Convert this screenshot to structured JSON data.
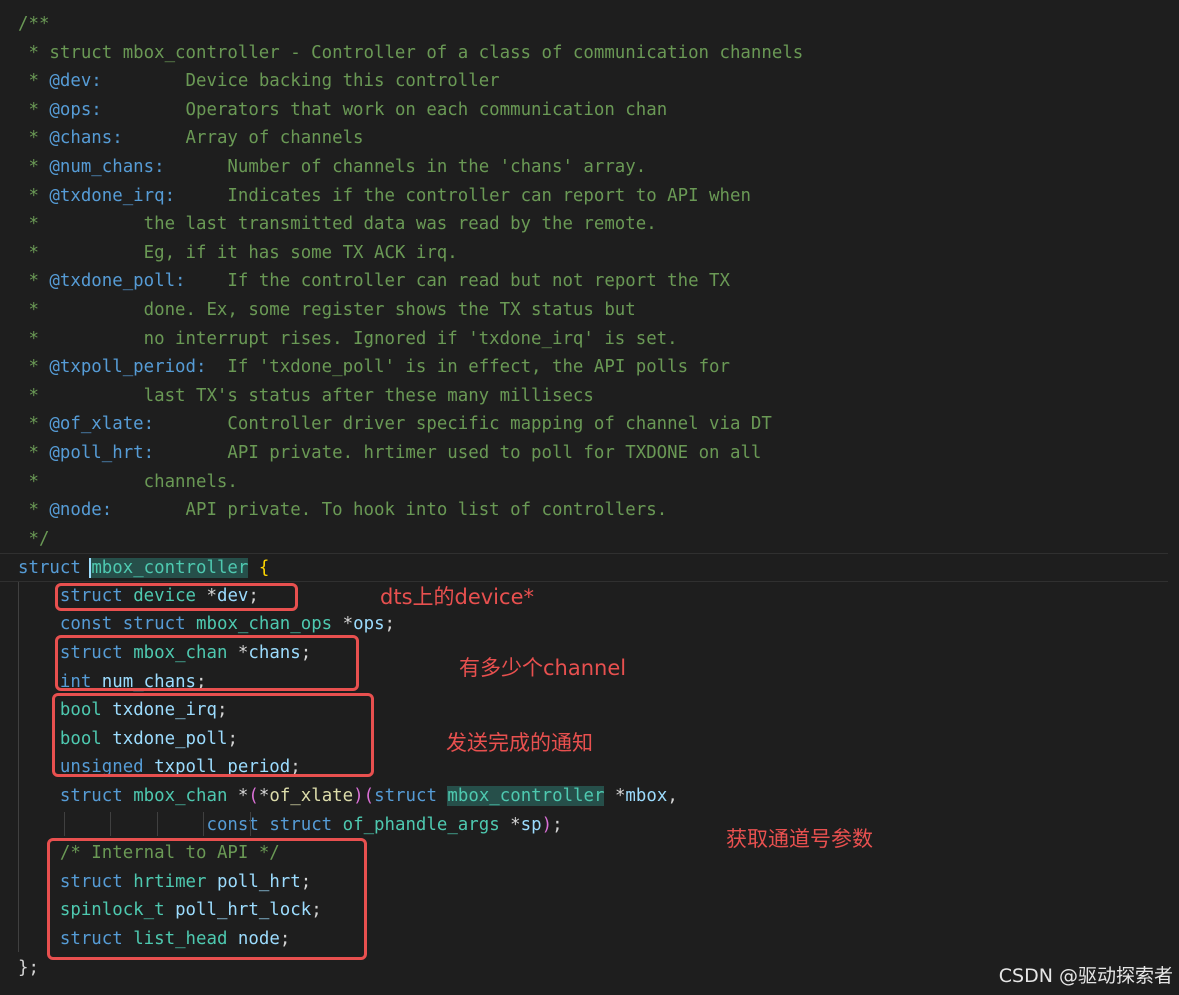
{
  "code_lines": [
    [
      [
        "/**",
        "cmt"
      ]
    ],
    [
      [
        " * struct mbox_controller - Controller of a class of communication channels",
        "cmt"
      ]
    ],
    [
      [
        " * ",
        "cmt"
      ],
      [
        "@dev:",
        "cdoc"
      ],
      [
        "        Device backing this controller",
        "cmt"
      ]
    ],
    [
      [
        " * ",
        "cmt"
      ],
      [
        "@ops:",
        "cdoc"
      ],
      [
        "        Operators that work on each communication chan",
        "cmt"
      ]
    ],
    [
      [
        " * ",
        "cmt"
      ],
      [
        "@chans:",
        "cdoc"
      ],
      [
        "      Array of channels",
        "cmt"
      ]
    ],
    [
      [
        " * ",
        "cmt"
      ],
      [
        "@num_chans:",
        "cdoc"
      ],
      [
        "      Number of channels in the 'chans' array.",
        "cmt"
      ]
    ],
    [
      [
        " * ",
        "cmt"
      ],
      [
        "@txdone_irq:",
        "cdoc"
      ],
      [
        "     Indicates if the controller can report to API when",
        "cmt"
      ]
    ],
    [
      [
        " *          the last transmitted data was read by the remote.",
        "cmt"
      ]
    ],
    [
      [
        " *          Eg, if it has some TX ACK irq.",
        "cmt"
      ]
    ],
    [
      [
        " * ",
        "cmt"
      ],
      [
        "@txdone_poll:",
        "cdoc"
      ],
      [
        "    If the controller can read but not report the TX",
        "cmt"
      ]
    ],
    [
      [
        " *          done. Ex, some register shows the TX status but",
        "cmt"
      ]
    ],
    [
      [
        " *          no interrupt rises. Ignored if 'txdone_irq' is set.",
        "cmt"
      ]
    ],
    [
      [
        " * ",
        "cmt"
      ],
      [
        "@txpoll_period:",
        "cdoc"
      ],
      [
        "  If 'txdone_poll' is in effect, the API polls for",
        "cmt"
      ]
    ],
    [
      [
        " *          last TX's status after these many millisecs",
        "cmt"
      ]
    ],
    [
      [
        " * ",
        "cmt"
      ],
      [
        "@of_xlate:",
        "cdoc"
      ],
      [
        "       Controller driver specific mapping of channel via DT",
        "cmt"
      ]
    ],
    [
      [
        " * ",
        "cmt"
      ],
      [
        "@poll_hrt:",
        "cdoc"
      ],
      [
        "       API private. hrtimer used to poll for TXDONE on all",
        "cmt"
      ]
    ],
    [
      [
        " *          channels.",
        "cmt"
      ]
    ],
    [
      [
        " * ",
        "cmt"
      ],
      [
        "@node:",
        "cdoc"
      ],
      [
        "       API private. To hook into list of controllers.",
        "cmt"
      ]
    ],
    [
      [
        " */",
        "cmt"
      ]
    ],
    [
      [
        "struct",
        "kw"
      ],
      [
        " ",
        "pun"
      ],
      [
        "mbox_controller",
        "ty name-hl edge"
      ],
      [
        " ",
        "pun"
      ],
      [
        "{",
        "brace"
      ]
    ],
    [
      [
        "    ",
        "pun"
      ],
      [
        "struct",
        "kw"
      ],
      [
        " ",
        "pun"
      ],
      [
        "device",
        "ty"
      ],
      [
        " *",
        "pun"
      ],
      [
        "dev",
        "var"
      ],
      [
        ";",
        "pun"
      ]
    ],
    [
      [
        "    ",
        "pun"
      ],
      [
        "const",
        "kw"
      ],
      [
        " ",
        "pun"
      ],
      [
        "struct",
        "kw"
      ],
      [
        " ",
        "pun"
      ],
      [
        "mbox_chan_ops",
        "ty"
      ],
      [
        " *",
        "pun"
      ],
      [
        "ops",
        "var"
      ],
      [
        ";",
        "pun"
      ]
    ],
    [
      [
        "    ",
        "pun"
      ],
      [
        "struct",
        "kw"
      ],
      [
        " ",
        "pun"
      ],
      [
        "mbox_chan",
        "ty"
      ],
      [
        " *",
        "pun"
      ],
      [
        "chans",
        "var"
      ],
      [
        ";",
        "pun"
      ]
    ],
    [
      [
        "    ",
        "pun"
      ],
      [
        "int",
        "kw"
      ],
      [
        " ",
        "pun"
      ],
      [
        "num_chans",
        "var"
      ],
      [
        ";",
        "pun"
      ]
    ],
    [
      [
        "    ",
        "pun"
      ],
      [
        "bool",
        "ty"
      ],
      [
        " ",
        "pun"
      ],
      [
        "txdone_irq",
        "var"
      ],
      [
        ";",
        "pun"
      ]
    ],
    [
      [
        "    ",
        "pun"
      ],
      [
        "bool",
        "ty"
      ],
      [
        " ",
        "pun"
      ],
      [
        "txdone_poll",
        "var"
      ],
      [
        ";",
        "pun"
      ]
    ],
    [
      [
        "    ",
        "pun"
      ],
      [
        "unsigned",
        "kw"
      ],
      [
        " ",
        "pun"
      ],
      [
        "txpoll_period",
        "var"
      ],
      [
        ";",
        "pun"
      ]
    ],
    [
      [
        "    ",
        "pun"
      ],
      [
        "struct",
        "kw"
      ],
      [
        " ",
        "pun"
      ],
      [
        "mbox_chan",
        "ty"
      ],
      [
        " *",
        "pun"
      ],
      [
        "(",
        "paren"
      ],
      [
        "*",
        "pun"
      ],
      [
        "of_xlate",
        "fn"
      ],
      [
        ")",
        "paren"
      ],
      [
        "(",
        "paren"
      ],
      [
        "struct",
        "kw"
      ],
      [
        " ",
        "pun"
      ],
      [
        "mbox_controller",
        "ty name-hl"
      ],
      [
        " *",
        "pun"
      ],
      [
        "mbox",
        "var"
      ],
      [
        ",",
        "pun"
      ]
    ],
    [
      [
        "                  ",
        "pun"
      ],
      [
        "const",
        "kw"
      ],
      [
        " ",
        "pun"
      ],
      [
        "struct",
        "kw"
      ],
      [
        " ",
        "pun"
      ],
      [
        "of_phandle_args",
        "ty"
      ],
      [
        " *",
        "pun"
      ],
      [
        "sp",
        "var"
      ],
      [
        ")",
        "paren"
      ],
      [
        ";",
        "pun"
      ]
    ],
    [
      [
        "    ",
        "pun"
      ],
      [
        "/* Internal to API */",
        "cmt"
      ]
    ],
    [
      [
        "    ",
        "pun"
      ],
      [
        "struct",
        "kw"
      ],
      [
        " ",
        "pun"
      ],
      [
        "hrtimer",
        "ty"
      ],
      [
        " ",
        "pun"
      ],
      [
        "poll_hrt",
        "var"
      ],
      [
        ";",
        "pun"
      ]
    ],
    [
      [
        "    ",
        "pun"
      ],
      [
        "spinlock_t",
        "ty"
      ],
      [
        " ",
        "pun"
      ],
      [
        "poll_hrt_lock",
        "var"
      ],
      [
        ";",
        "pun"
      ]
    ],
    [
      [
        "    ",
        "pun"
      ],
      [
        "struct",
        "kw"
      ],
      [
        " ",
        "pun"
      ],
      [
        "list_head",
        "ty"
      ],
      [
        " ",
        "pun"
      ],
      [
        "node",
        "var"
      ],
      [
        ";",
        "pun"
      ]
    ],
    [
      [
        "};",
        "pun"
      ]
    ]
  ],
  "annotations": {
    "dev_note": "dts上的device*",
    "chans_note": "有多少个channel",
    "txdone_note": "发送完成的通知",
    "xlate_note": "获取通道号参数"
  },
  "watermark": "CSDN @驱动探索者",
  "colors": {
    "background": "#1e1e1e",
    "comment": "#6a9955",
    "keyword": "#569cd6",
    "type": "#4ec9b0",
    "variable": "#9cdcfe",
    "function": "#dcdcaa",
    "annotation": "#e8504f"
  }
}
